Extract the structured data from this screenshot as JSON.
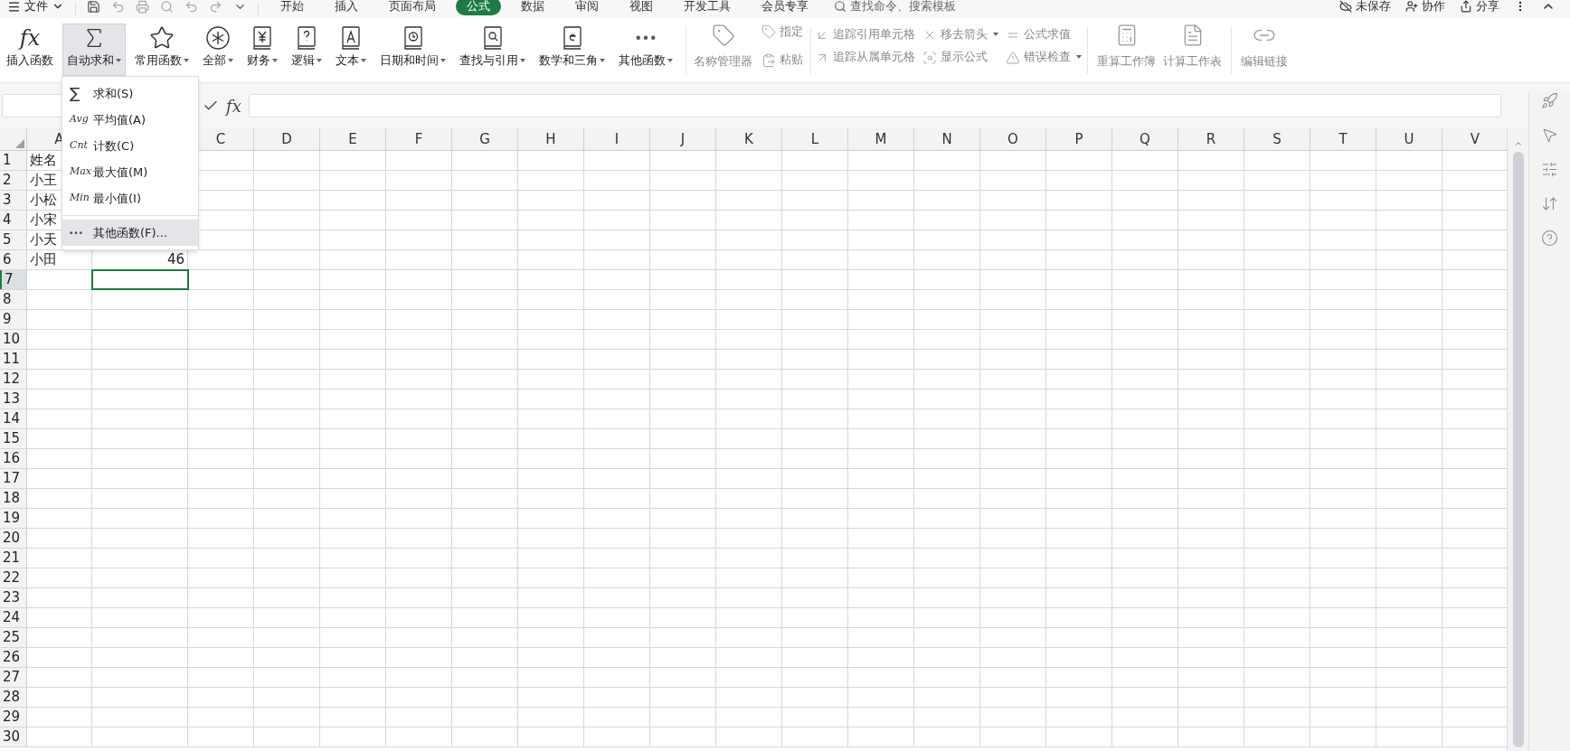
{
  "menu_bar": {
    "file_menu": "文件",
    "tabs": [
      {
        "label": "开始",
        "selected": false
      },
      {
        "label": "插入",
        "selected": false
      },
      {
        "label": "页面布局",
        "selected": false
      },
      {
        "label": "公式",
        "selected": true
      },
      {
        "label": "数据",
        "selected": false
      },
      {
        "label": "审阅",
        "selected": false
      },
      {
        "label": "视图",
        "selected": false
      },
      {
        "label": "开发工具",
        "selected": false
      },
      {
        "label": "会员专享",
        "selected": false
      }
    ],
    "search": {
      "placeholder": "查找命令、搜索模板"
    },
    "right_actions": [
      "未保存",
      "协作",
      "分享"
    ]
  },
  "ribbon": {
    "function_buttons": [
      {
        "label": "插入函数",
        "glyph": "fx",
        "caret": false,
        "expanded": false
      },
      {
        "label": "自动求和",
        "caret": true,
        "expanded": true
      },
      {
        "label": "常用函数",
        "caret": true,
        "expanded": false
      },
      {
        "label": "全部",
        "caret": true,
        "expanded": false
      },
      {
        "label": "财务",
        "caret": true,
        "expanded": false
      },
      {
        "label": "逻辑",
        "caret": true,
        "expanded": false
      },
      {
        "label": "文本",
        "caret": true,
        "expanded": false
      },
      {
        "label": "日期和时间",
        "caret": true,
        "expanded": false
      },
      {
        "label": "查找与引用",
        "caret": true,
        "expanded": false
      },
      {
        "label": "数学和三角",
        "caret": true,
        "expanded": false
      },
      {
        "label": "其他函数",
        "caret": true,
        "expanded": false
      }
    ],
    "name_manager": {
      "label": "名称管理器",
      "disabled": true
    },
    "name_actions": [
      {
        "label": "指定",
        "disabled": true
      },
      {
        "label": "粘贴",
        "disabled": true
      }
    ],
    "audit_actions": [
      {
        "label": "追踪引用单元格",
        "caret": false,
        "disabled": true
      },
      {
        "label": "追踪从属单元格",
        "caret": false,
        "disabled": true
      },
      {
        "label": "移去箭头",
        "caret": true,
        "disabled": true
      },
      {
        "label": "显示公式",
        "caret": false,
        "disabled": true
      },
      {
        "label": "公式求值",
        "caret": false,
        "disabled": true
      },
      {
        "label": "错误检查",
        "caret": true,
        "disabled": true
      }
    ],
    "calc_buttons": [
      {
        "label": "重算工作簿",
        "disabled": true
      },
      {
        "label": "计算工作表",
        "disabled": true
      }
    ],
    "link_button": {
      "label": "编辑链接",
      "disabled": true
    }
  },
  "autosum_menu": {
    "items": [
      {
        "glyph": "∑",
        "label": "求和(S)",
        "selected": false
      },
      {
        "glyph": "Avg",
        "label": "平均值(A)",
        "selected": false
      },
      {
        "glyph": "Cnt",
        "label": "计数(C)",
        "selected": false
      },
      {
        "glyph": "Max",
        "label": "最大值(M)",
        "selected": false
      },
      {
        "glyph": "Min",
        "label": "最小值(I)",
        "selected": false
      },
      {
        "label": "其他函数(F)...",
        "selected": true
      }
    ]
  },
  "formula_bar": {
    "function_glyph": "fx"
  },
  "sheet": {
    "columns": [
      "A",
      null,
      "C",
      "D",
      "E",
      "F",
      "G",
      "H",
      "I",
      "J",
      "K",
      "L",
      "M",
      "N",
      "O",
      "P",
      "Q",
      "R",
      "S",
      "T",
      "U",
      "V"
    ],
    "rows": [
      {
        "label": "1",
        "cells": [
          {
            "value": "姓名",
            "active": false
          }
        ]
      },
      {
        "label": "2",
        "cells": [
          {
            "value": "小王",
            "active": false
          }
        ]
      },
      {
        "label": "3",
        "cells": [
          {
            "value": "小松",
            "active": false
          }
        ]
      },
      {
        "label": "4",
        "cells": [
          {
            "value": "小宋",
            "active": false
          }
        ]
      },
      {
        "label": "5",
        "cells": [
          {
            "value": "小天",
            "active": false
          }
        ]
      },
      {
        "label": "6",
        "cells": [
          {
            "value": "小田",
            "active": false
          },
          {
            "value": "46",
            "active": false
          }
        ]
      },
      {
        "label": "7",
        "cells": [
          null,
          {
            "active": true
          }
        ]
      },
      {
        "label": "8"
      },
      {
        "label": "9"
      },
      {
        "label": "10"
      },
      {
        "label": "11"
      },
      {
        "label": "12"
      },
      {
        "label": "13"
      },
      {
        "label": "14"
      },
      {
        "label": "15"
      },
      {
        "label": "16"
      },
      {
        "label": "17"
      },
      {
        "label": "18"
      },
      {
        "label": "19"
      },
      {
        "label": "20"
      },
      {
        "label": "21"
      },
      {
        "label": "22"
      },
      {
        "label": "23"
      },
      {
        "label": "24"
      },
      {
        "label": "25"
      },
      {
        "label": "26"
      },
      {
        "label": "27"
      },
      {
        "label": "28"
      },
      {
        "label": "29"
      },
      {
        "label": "30"
      }
    ]
  }
}
